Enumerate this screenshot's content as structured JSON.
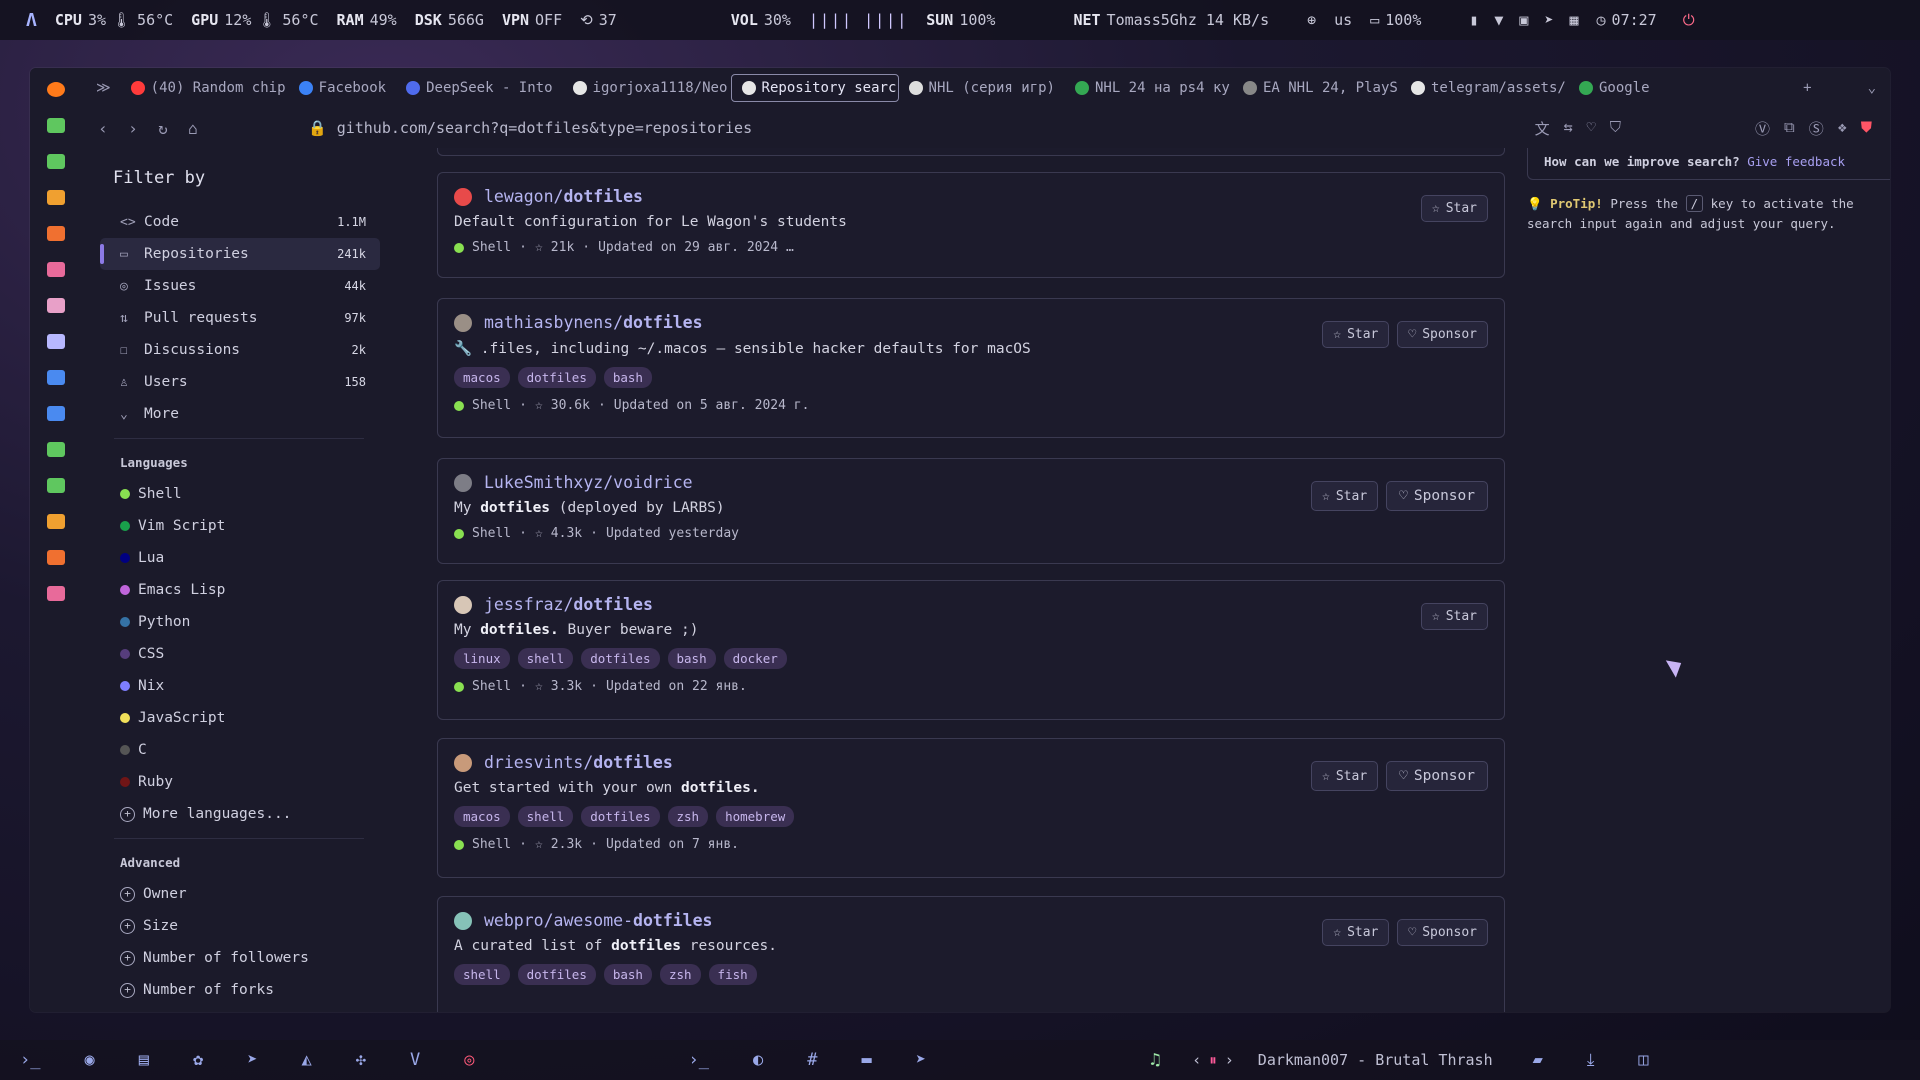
{
  "statusbar": {
    "cpu_label": "CPU",
    "cpu_value": "3%",
    "cpu_temp": "56°C",
    "gpu_label": "GPU",
    "gpu_value": "12%",
    "gpu_temp": "56°C",
    "ram_label": "RAM",
    "ram_value": "49%",
    "dsk_label": "DSK",
    "dsk_value": "566G",
    "vpn_label": "VPN",
    "vpn_value": "OFF",
    "updates_value": "37",
    "vol_label": "VOL",
    "vol_value": "30%",
    "sun_label": "SUN",
    "sun_value": "100%",
    "net_label": "NET",
    "net_value": "Tomass5Ghz 14 KB/s",
    "kbd_layout": "us",
    "battery_value": "100%",
    "clock": "07:27"
  },
  "tabs": [
    {
      "label": "(40) Random chip",
      "color": "#ff3b3b"
    },
    {
      "label": "Facebook",
      "color": "#3b82f6"
    },
    {
      "label": "DeepSeek - Into",
      "color": "#4f6bed"
    },
    {
      "label": "igorjoxa1118/Neo",
      "color": "#e6e6e6"
    },
    {
      "label": "Repository searc",
      "color": "#e6e6e6"
    },
    {
      "label": "NHL (серия игр)",
      "color": "#dddddd"
    },
    {
      "label": "NHL 24 на ps4 ку",
      "color": "#34a853"
    },
    {
      "label": "EA NHL 24, PlayS",
      "color": "#888888"
    },
    {
      "label": "telegram/assets/",
      "color": "#e6e6e6"
    },
    {
      "label": "Google",
      "color": "#34a853"
    }
  ],
  "url": "github.com/search?q=dotfiles&type=repositories",
  "filters": {
    "title": "Filter by",
    "types": [
      {
        "label": "Code",
        "count": "1.1M",
        "icon": "<>"
      },
      {
        "label": "Repositories",
        "count": "241k",
        "icon": "▭"
      },
      {
        "label": "Issues",
        "count": "44k",
        "icon": "◎"
      },
      {
        "label": "Pull requests",
        "count": "97k",
        "icon": "⇅"
      },
      {
        "label": "Discussions",
        "count": "2k",
        "icon": "☐"
      },
      {
        "label": "Users",
        "count": "158",
        "icon": "♙"
      },
      {
        "label": "More",
        "count": "",
        "icon": "⌄"
      }
    ],
    "languages_title": "Languages",
    "languages": [
      {
        "label": "Shell",
        "color": "#89e051"
      },
      {
        "label": "Vim Script",
        "color": "#199f4b"
      },
      {
        "label": "Lua",
        "color": "#000080"
      },
      {
        "label": "Emacs Lisp",
        "color": "#c065db"
      },
      {
        "label": "Python",
        "color": "#3572a5"
      },
      {
        "label": "CSS",
        "color": "#563d7c"
      },
      {
        "label": "Nix",
        "color": "#7e7eff"
      },
      {
        "label": "JavaScript",
        "color": "#f1e05a"
      },
      {
        "label": "C",
        "color": "#555555"
      },
      {
        "label": "Ruby",
        "color": "#701516"
      }
    ],
    "more_languages": "More languages...",
    "advanced_title": "Advanced",
    "advanced": [
      "Owner",
      "Size",
      "Number of followers",
      "Number of forks"
    ]
  },
  "results": [
    {
      "owner": "lewagon/",
      "repo": "dotfiles",
      "desc_pre": "Default configuration for Le Wagon's students",
      "desc_bold": "",
      "desc_post": "",
      "tags": [],
      "lang": "Shell",
      "stars": "21k",
      "updated": "Updated on 29 авг. 2024 …",
      "sponsor": false,
      "avatar": "#e84a4a"
    },
    {
      "owner": "mathiasbynens/",
      "repo": "dotfiles",
      "desc_pre": "🔧 .files, including ~/.macos — sensible hacker defaults for macOS",
      "desc_bold": "",
      "desc_post": "",
      "tags": [
        "macos",
        "dotfiles",
        "bash"
      ],
      "lang": "Shell",
      "stars": "30.6k",
      "updated": "Updated on 5 авг. 2024 г.",
      "sponsor": true,
      "avatar": "#9a8f86"
    },
    {
      "owner": "LukeSmithxyz/voidrice",
      "repo": "",
      "desc_pre": "My ",
      "desc_bold": "dotfiles",
      "desc_post": " (deployed by LARBS)",
      "tags": [],
      "lang": "Shell",
      "stars": "4.3k",
      "updated": "Updated yesterday",
      "sponsor": true,
      "avatar": "#7d7d86"
    },
    {
      "owner": "jessfraz/",
      "repo": "dotfiles",
      "desc_pre": "My ",
      "desc_bold": "dotfiles.",
      "desc_post": " Buyer beware ;)",
      "tags": [
        "linux",
        "shell",
        "dotfiles",
        "bash",
        "docker"
      ],
      "lang": "Shell",
      "stars": "3.3k",
      "updated": "Updated on 22 янв.",
      "sponsor": false,
      "avatar": "#d7c6b6"
    },
    {
      "owner": "driesvints/",
      "repo": "dotfiles",
      "desc_pre": "Get started with your own ",
      "desc_bold": "dotfiles.",
      "desc_post": "",
      "tags": [
        "macos",
        "shell",
        "dotfiles",
        "zsh",
        "homebrew"
      ],
      "lang": "Shell",
      "stars": "2.3k",
      "updated": "Updated on 7 янв.",
      "sponsor": true,
      "avatar": "#c89a7a"
    },
    {
      "owner": "webpro/awesome-",
      "repo": "dotfiles",
      "desc_pre": "A curated list of ",
      "desc_bold": "dotfiles",
      "desc_post": " resources.",
      "tags": [
        "shell",
        "dotfiles",
        "bash",
        "zsh",
        "fish"
      ],
      "lang": "",
      "stars": "",
      "updated": "",
      "sponsor": true,
      "avatar": "#86c2b8"
    }
  ],
  "buttons": {
    "star": "Star",
    "sponsor": "Sponsor"
  },
  "rpanel": {
    "feedback_q": "How can we improve search?",
    "feedback_link": "Give feedback",
    "protip_label": "ProTip!",
    "protip_pre": "Press the",
    "protip_key": "/",
    "protip_post": "key to activate the search input again and adjust your query."
  },
  "taskbar": {
    "now_playing": "Darkman007 - Brutal Thrash"
  }
}
